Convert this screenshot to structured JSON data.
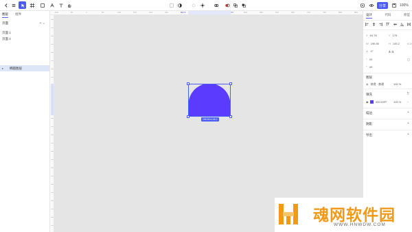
{
  "toolbar": {
    "share_label": "分享",
    "zoom": "100%"
  },
  "left_panel": {
    "tabs": [
      "图层",
      "组件"
    ],
    "section_title": "页面",
    "section_actions": "+  ⌄",
    "pages": [
      "页面 1",
      "页面 2"
    ],
    "layer_name": "椭圆图层"
  },
  "ruler": {
    "top_labels": [
      "-100",
      "-50",
      "0",
      "50",
      "100",
      "150",
      "200",
      "250",
      "300",
      "350",
      "400",
      "450",
      "500",
      "550",
      "600",
      "650",
      "700",
      "750",
      "800",
      "850"
    ],
    "hl_left": "64.76",
    "hl_right": "176"
  },
  "canvas": {
    "shape_color": "#5b3cff",
    "dimension_badge": "196.50×145.2"
  },
  "right_panel": {
    "tabs": [
      "设计",
      "代码",
      "原型"
    ],
    "x_label": "X",
    "x_value": "64.76",
    "y_label": "Y",
    "y_value": "176",
    "w_label": "W",
    "w_value": "196.50",
    "h_label": "H",
    "h_value": "145.2",
    "rotation": "0°",
    "radius": "20",
    "clip": "40",
    "layer_section": "图层",
    "blend_mode": "穿透 · 普通",
    "opacity": "100 %",
    "fill_section": "填充",
    "fill_hex": "#5C40FF",
    "fill_opacity": "100 %",
    "stroke_section": "描边",
    "shadow_section": "阴影",
    "export_section": "导出"
  },
  "watermark": {
    "title": "魂网软件园",
    "url": "WWW.HNWDW.COM"
  }
}
